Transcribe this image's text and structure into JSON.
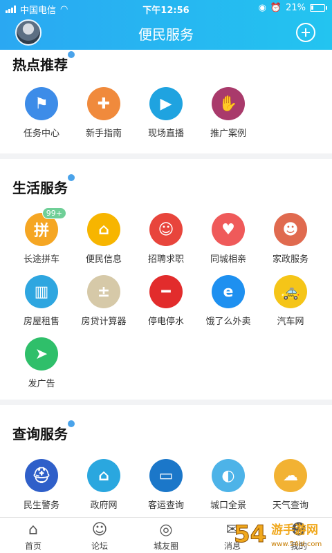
{
  "status_bar": {
    "carrier": "中国电信",
    "time": "下午12:56",
    "battery": "21%",
    "battery_level": 0.21
  },
  "header": {
    "title": "便民服务",
    "avatar": "avatar",
    "add_icon": "plus-circle-icon"
  },
  "sections": {
    "hot": {
      "title": "热点推荐",
      "items": [
        {
          "label": "任务中心",
          "icon": "flag-icon",
          "color": "#3d8ce8"
        },
        {
          "label": "新手指南",
          "icon": "compass-icon",
          "color": "#f08a3c"
        },
        {
          "label": "现场直播",
          "icon": "video-camera-icon",
          "color": "#1fa3e0"
        },
        {
          "label": "推广案例",
          "icon": "handshake-icon",
          "color": "#a93a6b"
        }
      ]
    },
    "life": {
      "title": "生活服务",
      "items": [
        {
          "label": "长途拼车",
          "icon": "carpool-icon",
          "color": "#f5a623",
          "badge": "99+"
        },
        {
          "label": "便民信息",
          "icon": "home-icon",
          "color": "#f7b500"
        },
        {
          "label": "招聘求职",
          "icon": "job-seeker-icon",
          "color": "#e8453c"
        },
        {
          "label": "同城相亲",
          "icon": "heart-pulse-icon",
          "color": "#ef5a5a"
        },
        {
          "label": "家政服务",
          "icon": "housekeeper-icon",
          "color": "#e06a4f"
        },
        {
          "label": "房屋租售",
          "icon": "building-icon",
          "color": "#2ea6e0"
        },
        {
          "label": "房贷计算器",
          "icon": "calculator-icon",
          "color": "#d6c9a8"
        },
        {
          "label": "停电停水",
          "icon": "no-entry-icon",
          "color": "#e22c2c"
        },
        {
          "label": "饿了么外卖",
          "icon": "eleme-icon",
          "color": "#1e90f0"
        },
        {
          "label": "汽车网",
          "icon": "taxi-icon",
          "color": "#f5c518"
        },
        {
          "label": "发广告",
          "icon": "paper-plane-icon",
          "color": "#2fbf6a"
        }
      ]
    },
    "query": {
      "title": "查询服务",
      "items": [
        {
          "label": "民生警务",
          "icon": "police-cap-icon",
          "color": "#2f5fc9"
        },
        {
          "label": "政府网",
          "icon": "government-building-icon",
          "color": "#2aa7df"
        },
        {
          "label": "客运查询",
          "icon": "bus-icon",
          "color": "#1b77c9"
        },
        {
          "label": "城口全景",
          "icon": "globe-icon",
          "color": "#4db3e8"
        },
        {
          "label": "天气查询",
          "icon": "weather-icon",
          "color": "#f2b233"
        }
      ]
    }
  },
  "tabbar": {
    "items": [
      {
        "label": "首页",
        "icon": "home-outline-icon"
      },
      {
        "label": "论坛",
        "icon": "forum-icon"
      },
      {
        "label": "城友圈",
        "icon": "circle-icon"
      },
      {
        "label": "消息",
        "icon": "message-icon"
      },
      {
        "label": "我的",
        "icon": "user-icon"
      }
    ]
  },
  "watermark": {
    "text": "54游手游网",
    "sub": "www.54ld.com"
  }
}
